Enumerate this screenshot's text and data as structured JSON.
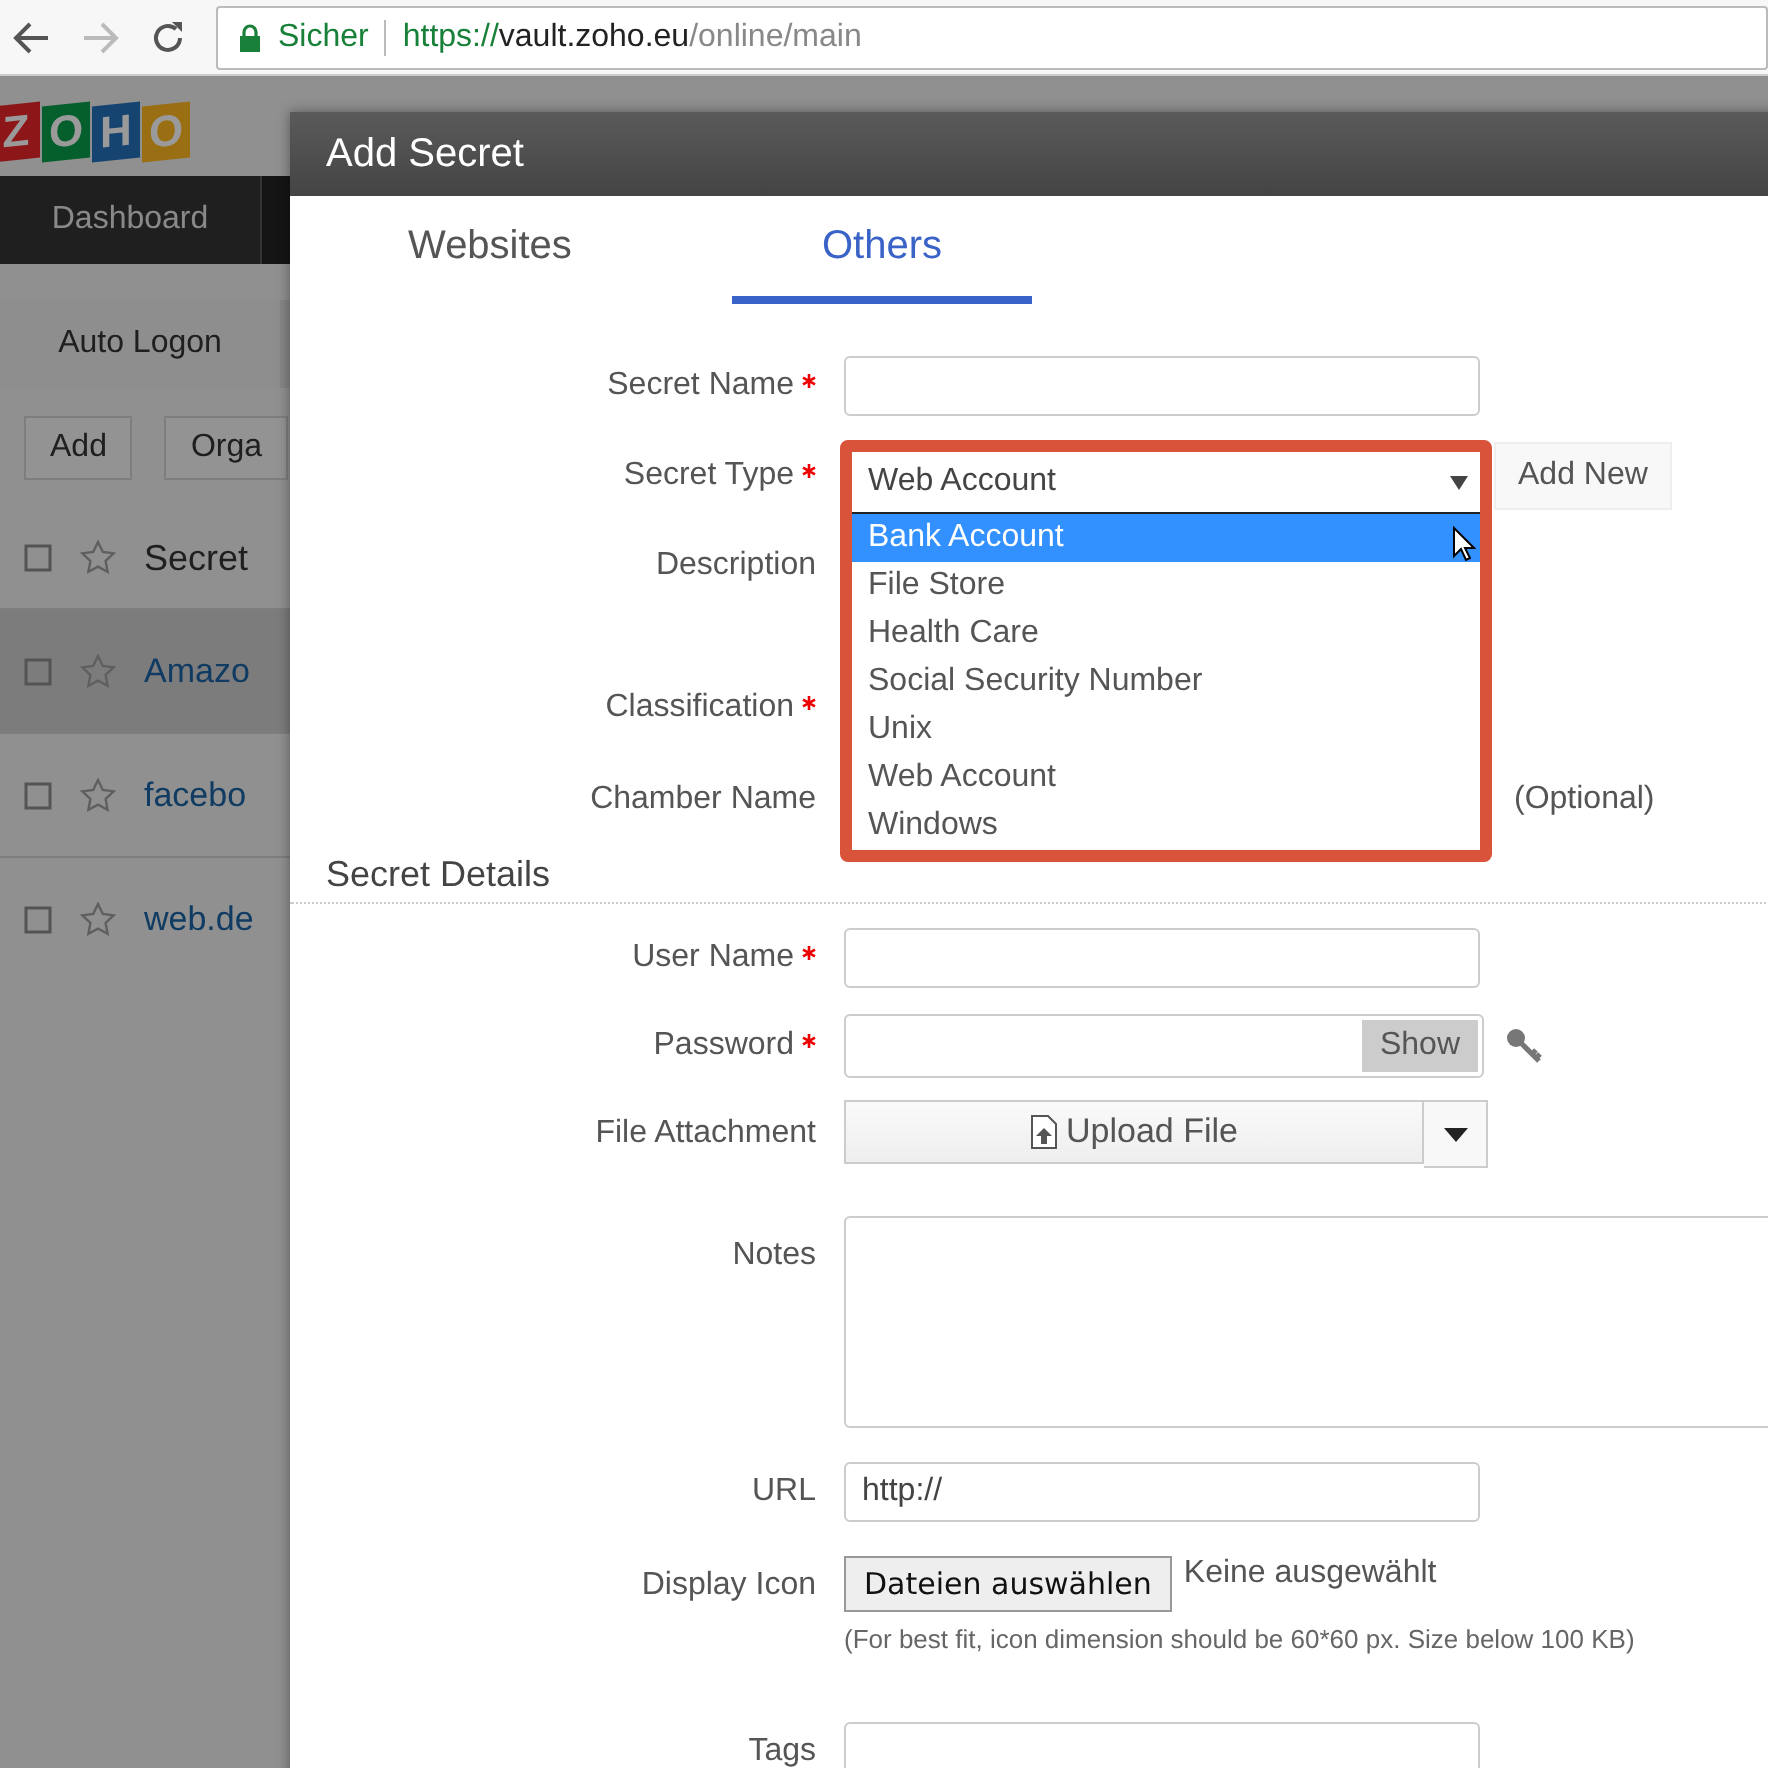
{
  "browser": {
    "security": "Sicher",
    "url": [
      "https://",
      "vault.zoho.eu",
      "/online/main"
    ]
  },
  "app": {
    "logo": [
      {
        "letter": "Z",
        "color": "#8d1718"
      },
      {
        "letter": "O",
        "color": "#055f2d"
      },
      {
        "letter": "H",
        "color": "#154470"
      },
      {
        "letter": "O",
        "color": "#9a6e12"
      }
    ],
    "nav": [
      {
        "label": "Dashboard"
      }
    ],
    "subnav": [
      {
        "label": "Auto Logon"
      }
    ],
    "toolbar": [
      "Add",
      "Orga"
    ],
    "list": {
      "header": "Secret",
      "rows": [
        {
          "name": "Amazo",
          "selected": true
        },
        {
          "name": "facebo",
          "selected": false
        },
        {
          "name": "web.de",
          "selected": false
        }
      ]
    }
  },
  "modal": {
    "title": "Add Secret",
    "tabs": [
      {
        "label": "Websites",
        "selected": false
      },
      {
        "label": "Others",
        "selected": true
      }
    ],
    "fields": [
      {
        "label": "Secret Name",
        "required": true,
        "kind": "text"
      },
      {
        "label": "Secret Type",
        "required": true,
        "kind": "select",
        "button": "Add New"
      },
      {
        "label": "Description",
        "required": false,
        "kind": "covered-tall"
      },
      {
        "label": "Classification",
        "required": true,
        "kind": "covered"
      },
      {
        "label": "Chamber Name",
        "required": false,
        "kind": "covered",
        "suffix": "(Optional)"
      }
    ],
    "section": "Secret Details",
    "details": [
      {
        "label": "User Name",
        "required": true,
        "kind": "text"
      },
      {
        "label": "Password",
        "required": true,
        "kind": "password",
        "button": "Show"
      },
      {
        "label": "File Attachment",
        "required": false,
        "kind": "upload",
        "button": "Upload File"
      },
      {
        "label": "Notes",
        "required": false,
        "kind": "textarea"
      },
      {
        "label": "URL",
        "required": false,
        "kind": "text",
        "value": "http://"
      },
      {
        "label": "Display Icon",
        "required": false,
        "kind": "file",
        "button": "Dateien auswählen",
        "status": "Keine ausgewählt",
        "hint": "(For best fit, icon dimension should be 60*60 px. Size below 100 KB)"
      },
      {
        "label": "Tags",
        "required": false,
        "kind": "text"
      }
    ]
  },
  "dropdown": {
    "value": "Web Account",
    "options": [
      {
        "label": "Bank Account",
        "highlighted": true
      },
      {
        "label": "File Store",
        "highlighted": false
      },
      {
        "label": "Health Care",
        "highlighted": false
      },
      {
        "label": "Social Security Number",
        "highlighted": false
      },
      {
        "label": "Unix",
        "highlighted": false
      },
      {
        "label": "Web Account",
        "highlighted": false
      },
      {
        "label": "Windows",
        "highlighted": false
      }
    ]
  }
}
